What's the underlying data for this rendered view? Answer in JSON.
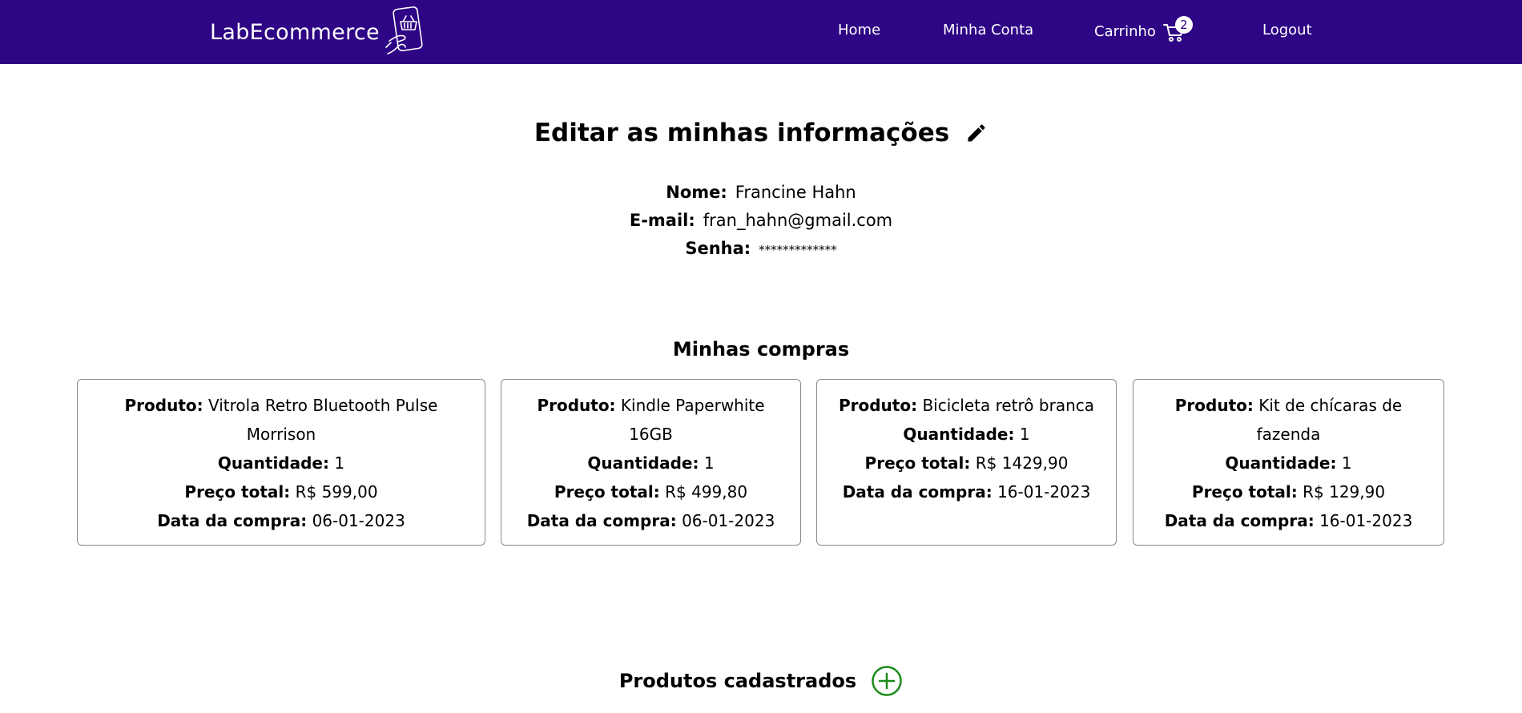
{
  "header": {
    "brand": "LabEcommerce",
    "nav": {
      "home": "Home",
      "account": "Minha Conta",
      "cart": "Carrinho",
      "cart_count": "2",
      "logout": "Logout"
    },
    "bg_color": "#2e0585"
  },
  "profile": {
    "title": "Editar as minhas informações",
    "fields": [
      {
        "label": "Nome:",
        "value": "Francine Hahn"
      },
      {
        "label": "E-mail:",
        "value": "fran_hahn@gmail.com"
      },
      {
        "label": "Senha:",
        "value": "*************"
      }
    ]
  },
  "purchases": {
    "title": "Minhas compras",
    "labels": {
      "product": "Produto:",
      "quantity": "Quantidade:",
      "total": "Preço total:",
      "date": "Data da compra:"
    },
    "items": [
      {
        "product": "Vitrola Retro Bluetooth Pulse Morrison",
        "quantity": "1",
        "total": "R$ 599,00",
        "date": "06-01-2023"
      },
      {
        "product": "Kindle Paperwhite 16GB",
        "quantity": "1",
        "total": "R$ 499,80",
        "date": "06-01-2023"
      },
      {
        "product": "Bicicleta retrô branca",
        "quantity": "1",
        "total": "R$ 1429,90",
        "date": "16-01-2023"
      },
      {
        "product": "Kit de chícaras de fazenda",
        "quantity": "1",
        "total": "R$ 129,90",
        "date": "16-01-2023"
      }
    ]
  },
  "products": {
    "title": "Produtos cadastrados",
    "add_icon_color": "#1a8a1a"
  }
}
